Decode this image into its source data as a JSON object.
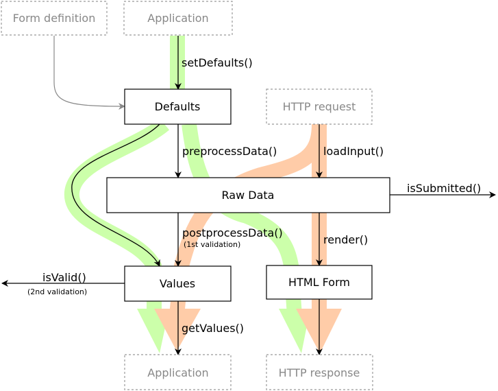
{
  "nodes": {
    "form_definition": "Form definition",
    "application_top": "Application",
    "defaults": "Defaults",
    "http_request": "HTTP request",
    "raw_data": "Raw Data",
    "values": "Values",
    "html_form": "HTML Form",
    "application_bottom": "Application",
    "http_response": "HTTP response"
  },
  "edges": {
    "set_defaults": "setDefaults()",
    "preprocess": "preprocessData()",
    "load_input": "loadInput()",
    "is_submitted": "isSubmitted()",
    "postprocess": "postprocessData()",
    "postprocess_note": "(1st validation)",
    "render": "render()",
    "is_valid": "isValid()",
    "is_valid_note": "(2nd validation)",
    "get_values": "getValues()"
  },
  "colors": {
    "flow_green": "#ccffaa",
    "flow_orange": "#ffcca8"
  }
}
